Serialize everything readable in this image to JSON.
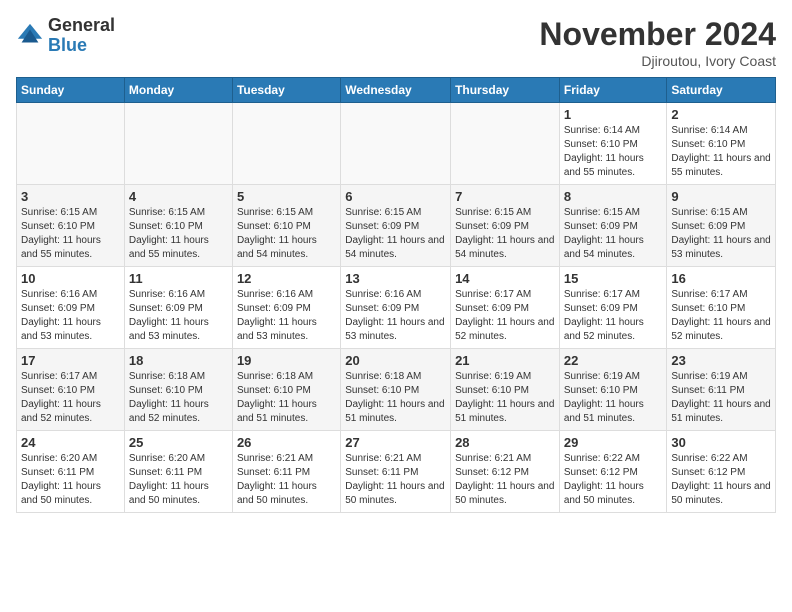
{
  "logo": {
    "general": "General",
    "blue": "Blue"
  },
  "title": {
    "month": "November 2024",
    "location": "Djiroutou, Ivory Coast"
  },
  "headers": [
    "Sunday",
    "Monday",
    "Tuesday",
    "Wednesday",
    "Thursday",
    "Friday",
    "Saturday"
  ],
  "weeks": [
    [
      {
        "day": "",
        "info": ""
      },
      {
        "day": "",
        "info": ""
      },
      {
        "day": "",
        "info": ""
      },
      {
        "day": "",
        "info": ""
      },
      {
        "day": "",
        "info": ""
      },
      {
        "day": "1",
        "info": "Sunrise: 6:14 AM\nSunset: 6:10 PM\nDaylight: 11 hours and 55 minutes."
      },
      {
        "day": "2",
        "info": "Sunrise: 6:14 AM\nSunset: 6:10 PM\nDaylight: 11 hours and 55 minutes."
      }
    ],
    [
      {
        "day": "3",
        "info": "Sunrise: 6:15 AM\nSunset: 6:10 PM\nDaylight: 11 hours and 55 minutes."
      },
      {
        "day": "4",
        "info": "Sunrise: 6:15 AM\nSunset: 6:10 PM\nDaylight: 11 hours and 55 minutes."
      },
      {
        "day": "5",
        "info": "Sunrise: 6:15 AM\nSunset: 6:10 PM\nDaylight: 11 hours and 54 minutes."
      },
      {
        "day": "6",
        "info": "Sunrise: 6:15 AM\nSunset: 6:09 PM\nDaylight: 11 hours and 54 minutes."
      },
      {
        "day": "7",
        "info": "Sunrise: 6:15 AM\nSunset: 6:09 PM\nDaylight: 11 hours and 54 minutes."
      },
      {
        "day": "8",
        "info": "Sunrise: 6:15 AM\nSunset: 6:09 PM\nDaylight: 11 hours and 54 minutes."
      },
      {
        "day": "9",
        "info": "Sunrise: 6:15 AM\nSunset: 6:09 PM\nDaylight: 11 hours and 53 minutes."
      }
    ],
    [
      {
        "day": "10",
        "info": "Sunrise: 6:16 AM\nSunset: 6:09 PM\nDaylight: 11 hours and 53 minutes."
      },
      {
        "day": "11",
        "info": "Sunrise: 6:16 AM\nSunset: 6:09 PM\nDaylight: 11 hours and 53 minutes."
      },
      {
        "day": "12",
        "info": "Sunrise: 6:16 AM\nSunset: 6:09 PM\nDaylight: 11 hours and 53 minutes."
      },
      {
        "day": "13",
        "info": "Sunrise: 6:16 AM\nSunset: 6:09 PM\nDaylight: 11 hours and 53 minutes."
      },
      {
        "day": "14",
        "info": "Sunrise: 6:17 AM\nSunset: 6:09 PM\nDaylight: 11 hours and 52 minutes."
      },
      {
        "day": "15",
        "info": "Sunrise: 6:17 AM\nSunset: 6:09 PM\nDaylight: 11 hours and 52 minutes."
      },
      {
        "day": "16",
        "info": "Sunrise: 6:17 AM\nSunset: 6:10 PM\nDaylight: 11 hours and 52 minutes."
      }
    ],
    [
      {
        "day": "17",
        "info": "Sunrise: 6:17 AM\nSunset: 6:10 PM\nDaylight: 11 hours and 52 minutes."
      },
      {
        "day": "18",
        "info": "Sunrise: 6:18 AM\nSunset: 6:10 PM\nDaylight: 11 hours and 52 minutes."
      },
      {
        "day": "19",
        "info": "Sunrise: 6:18 AM\nSunset: 6:10 PM\nDaylight: 11 hours and 51 minutes."
      },
      {
        "day": "20",
        "info": "Sunrise: 6:18 AM\nSunset: 6:10 PM\nDaylight: 11 hours and 51 minutes."
      },
      {
        "day": "21",
        "info": "Sunrise: 6:19 AM\nSunset: 6:10 PM\nDaylight: 11 hours and 51 minutes."
      },
      {
        "day": "22",
        "info": "Sunrise: 6:19 AM\nSunset: 6:10 PM\nDaylight: 11 hours and 51 minutes."
      },
      {
        "day": "23",
        "info": "Sunrise: 6:19 AM\nSunset: 6:11 PM\nDaylight: 11 hours and 51 minutes."
      }
    ],
    [
      {
        "day": "24",
        "info": "Sunrise: 6:20 AM\nSunset: 6:11 PM\nDaylight: 11 hours and 50 minutes."
      },
      {
        "day": "25",
        "info": "Sunrise: 6:20 AM\nSunset: 6:11 PM\nDaylight: 11 hours and 50 minutes."
      },
      {
        "day": "26",
        "info": "Sunrise: 6:21 AM\nSunset: 6:11 PM\nDaylight: 11 hours and 50 minutes."
      },
      {
        "day": "27",
        "info": "Sunrise: 6:21 AM\nSunset: 6:11 PM\nDaylight: 11 hours and 50 minutes."
      },
      {
        "day": "28",
        "info": "Sunrise: 6:21 AM\nSunset: 6:12 PM\nDaylight: 11 hours and 50 minutes."
      },
      {
        "day": "29",
        "info": "Sunrise: 6:22 AM\nSunset: 6:12 PM\nDaylight: 11 hours and 50 minutes."
      },
      {
        "day": "30",
        "info": "Sunrise: 6:22 AM\nSunset: 6:12 PM\nDaylight: 11 hours and 50 minutes."
      }
    ]
  ]
}
